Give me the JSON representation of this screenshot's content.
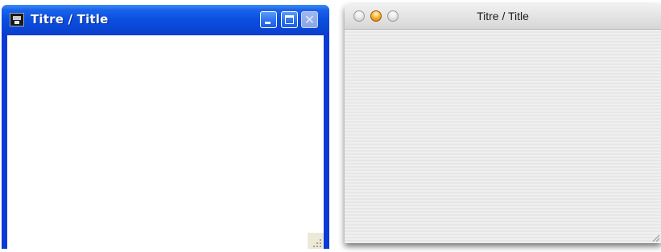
{
  "windows": {
    "xp": {
      "title": "Titre / Title",
      "icons": {
        "app": "application-icon",
        "minimize": "minimize-icon",
        "maximize": "maximize-icon",
        "close": "close-icon",
        "resize": "resize-grip-icon"
      },
      "close_glyph": "✕",
      "colors": {
        "frame": "#0a3bd6",
        "client": "#ffffff",
        "close_disabled": "#8aa6e8"
      }
    },
    "mac": {
      "title": "Titre / Title",
      "icons": {
        "close": "close-light-icon",
        "minimize": "minimize-light-icon",
        "zoom": "zoom-light-icon",
        "resize": "resize-grip-icon"
      },
      "colors": {
        "titlebar": "#e4e4e4",
        "client": "#ececec",
        "active_light": "#f8c150"
      }
    }
  }
}
